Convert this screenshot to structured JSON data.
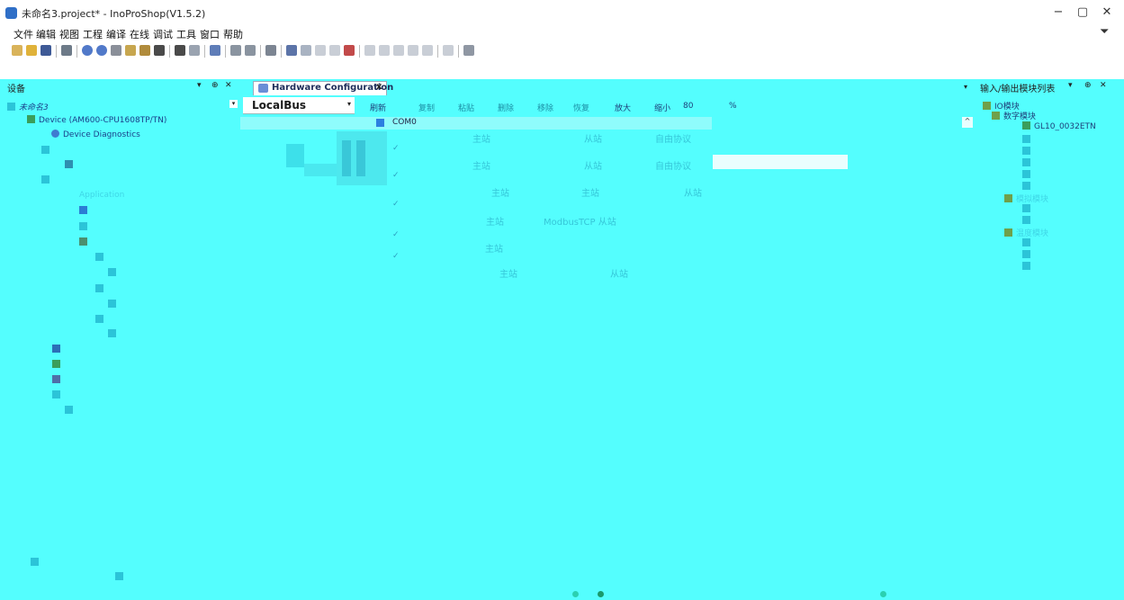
{
  "window": {
    "title": "未命名3.project* - InoProShop(V1.5.2)",
    "controls": [
      "−",
      "▢",
      "✕"
    ]
  },
  "menu": [
    "文件",
    "编辑",
    "视图",
    "工程",
    "编译",
    "在线",
    "调试",
    "工具",
    "窗口",
    "帮助"
  ],
  "colors": {
    "workspace": "#54fefe",
    "title_accent": "#2f6fc7"
  },
  "devices_panel": {
    "title": "设备",
    "controls": [
      "▾",
      "⊕",
      "✕"
    ],
    "root": "未命名3",
    "device": "Device (AM600-CPU1608TP/TN)",
    "diag": "Device Diagnostics",
    "application": "Application"
  },
  "hw_tab": {
    "label": "Hardware Configuration",
    "close": "x"
  },
  "hw_editor": {
    "bus_selected": "LocalBus",
    "toolbar": [
      "刷新",
      "复制",
      "粘贴",
      "删除",
      "移除",
      "恢复",
      "放大",
      "缩小"
    ],
    "zoom": "80",
    "zoom_unit": "%",
    "com0": "COM0",
    "protocols": [
      "主站",
      "从站",
      "自由协议",
      "主站",
      "从站",
      "自由协议",
      "主站",
      "主站",
      "从站",
      "主站",
      "ModbusTCP 从站",
      "主站",
      "主站",
      "从站"
    ]
  },
  "io_panel": {
    "title": "输入/输出模块列表",
    "controls": [
      "▾",
      "⊕",
      "✕"
    ],
    "items": [
      {
        "label": "IO模块",
        "faint": false
      },
      {
        "label": "数字模块",
        "faint": false
      },
      {
        "label": "GL10_0032ETN",
        "faint": false
      },
      {
        "label": "模拟模块",
        "faint": true
      },
      {
        "label": "温度模块",
        "faint": true
      }
    ]
  }
}
